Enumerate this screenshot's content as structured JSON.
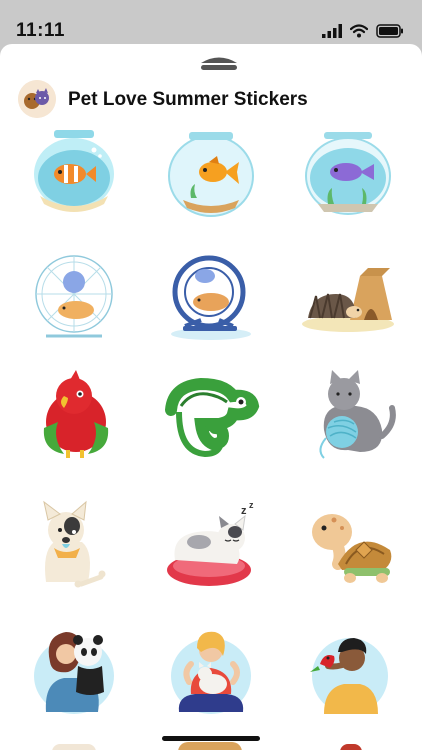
{
  "status": {
    "time": "11:11"
  },
  "header": {
    "title": "Pet Love Summer Stickers",
    "icon": "pets-app-icon"
  },
  "stickers": [
    {
      "name": "clownfish-bowl-sticker"
    },
    {
      "name": "goldfish-bowl-sticker"
    },
    {
      "name": "purple-fish-aquarium-sticker"
    },
    {
      "name": "hamster-wheel-outline-sticker"
    },
    {
      "name": "hamster-wheel-blue-sticker"
    },
    {
      "name": "hedgehog-house-sticker"
    },
    {
      "name": "red-parrot-sticker"
    },
    {
      "name": "green-chameleon-sticker"
    },
    {
      "name": "gray-cat-yarn-sticker"
    },
    {
      "name": "french-bulldog-sticker"
    },
    {
      "name": "sleeping-cat-sticker"
    },
    {
      "name": "tortoise-sticker"
    },
    {
      "name": "girl-hugging-panda-sticker"
    },
    {
      "name": "woman-with-cat-sticker"
    },
    {
      "name": "man-with-parrot-sticker"
    }
  ],
  "colors": {
    "accent_blue": "#3a5ea8",
    "water": "#8fd8e8",
    "background": "#ffffff"
  }
}
